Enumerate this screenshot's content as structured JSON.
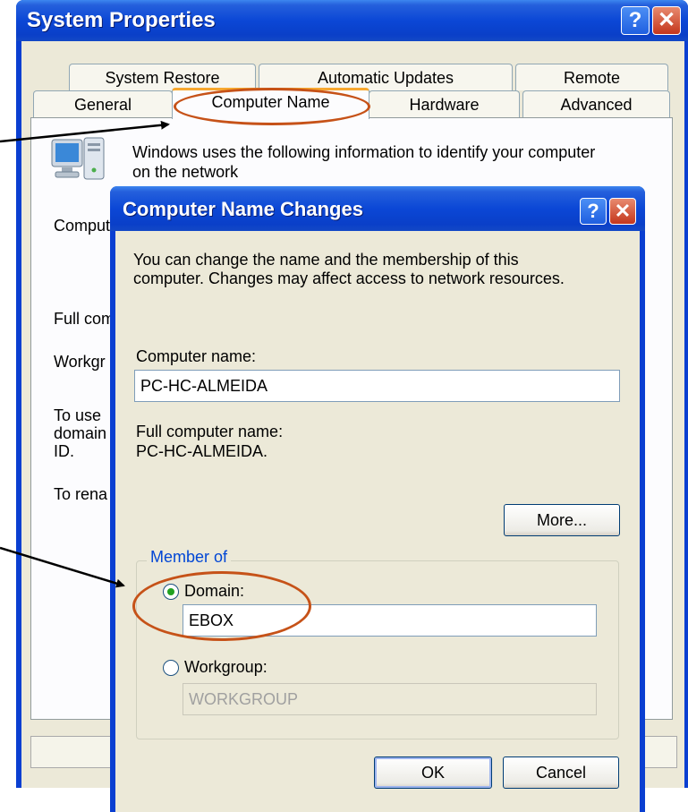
{
  "system_properties": {
    "title": "System Properties",
    "help_button": "?",
    "close_button": "✕",
    "tabs_row1": [
      "System Restore",
      "Automatic Updates",
      "Remote"
    ],
    "tabs_row2": [
      "General",
      "Computer Name",
      "Hardware",
      "Advanced"
    ],
    "selected_tab": "Computer Name",
    "panel": {
      "description_line1": "Windows uses the following information to identify your computer",
      "description_line2": "on the network",
      "computer_label_partial": "Comput",
      "full_computer_partial": "Full com",
      "workgroup_partial": "Workgr",
      "to_use_line1": "To use",
      "to_use_line2": "domain",
      "to_use_line3": "ID.",
      "to_rename_partial": "To rena"
    }
  },
  "computer_name_changes": {
    "title": "Computer Name Changes",
    "help_button": "?",
    "close_button": "✕",
    "intro_line1": "You can change the name and the membership of this",
    "intro_line2": "computer. Changes may affect access to network resources.",
    "computer_name_label": "Computer name:",
    "computer_name_value": "PC-HC-ALMEIDA",
    "full_computer_name_label": "Full computer name:",
    "full_computer_name_value": "PC-HC-ALMEIDA.",
    "more_button": "More...",
    "member_of_label": "Member of",
    "domain_label": "Domain:",
    "domain_value": "EBOX",
    "workgroup_label": "Workgroup:",
    "workgroup_value": "WORKGROUP",
    "ok_button": "OK",
    "cancel_button": "Cancel",
    "selected_membership": "Domain"
  },
  "colors": {
    "titlebar_blue": "#0a47d6",
    "annotation_orange": "#c65218",
    "selected_tab_accent": "#f7a82f",
    "group_label_blue": "#0046d5",
    "radio_dot_green": "#21a121"
  },
  "icons": {
    "computer_icon": "computer-monitor-icon",
    "help_icon": "help-icon",
    "close_icon": "close-icon"
  }
}
